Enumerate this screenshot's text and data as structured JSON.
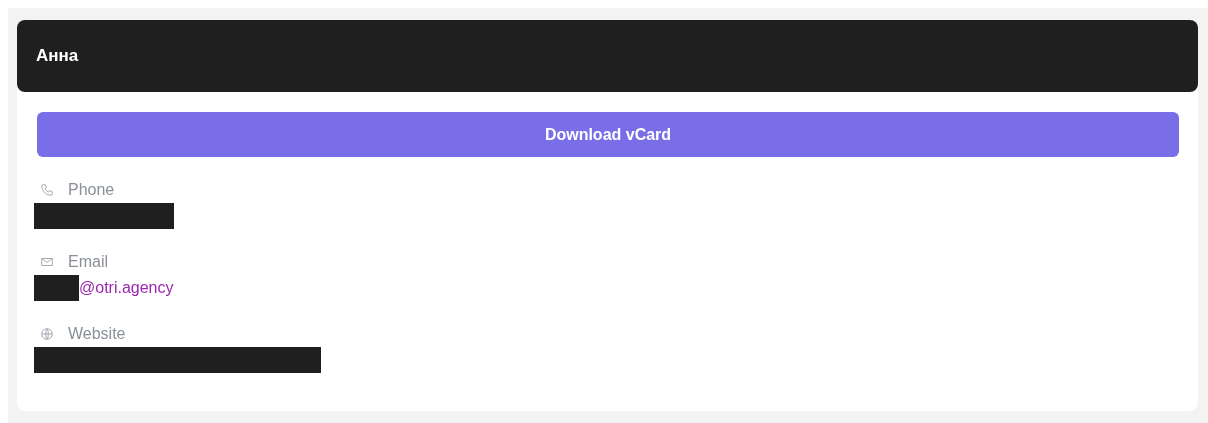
{
  "contact": {
    "name": "Анна"
  },
  "download_button": {
    "label": "Download vCard"
  },
  "fields": [
    {
      "kind": "phone",
      "label": "Phone",
      "redacted": true
    },
    {
      "kind": "email",
      "label": "Email",
      "redacted": true,
      "value": "@otri.agency"
    },
    {
      "kind": "website",
      "label": "Website",
      "redacted": true
    }
  ]
}
